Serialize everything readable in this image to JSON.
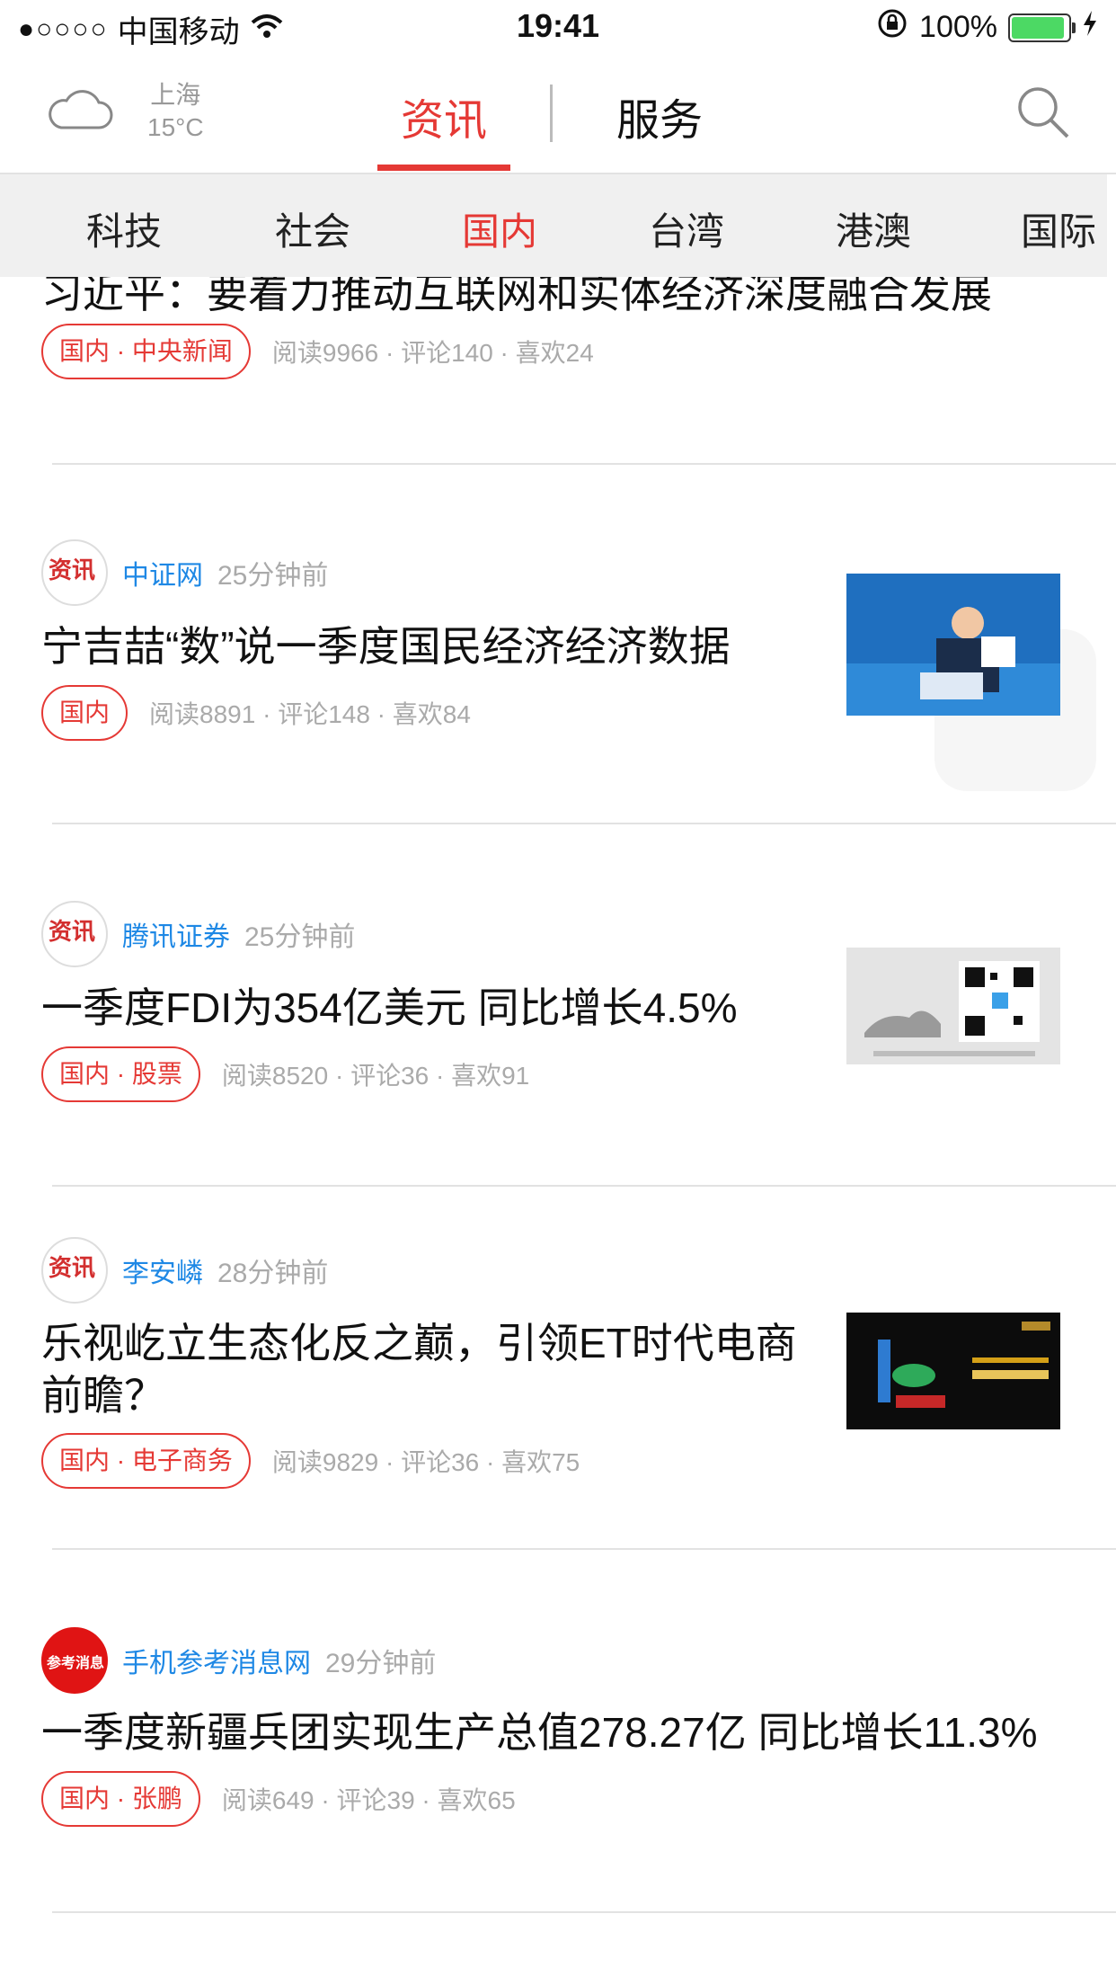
{
  "status_bar": {
    "signal_dots": "●○○○○",
    "carrier": "中国移动",
    "time": "19:41",
    "battery_percent_text": "100%",
    "battery_level": 1.0,
    "battery_color": "#4cd964"
  },
  "header": {
    "weather": {
      "city": "上海",
      "temp": "15°C",
      "icon": "cloud-icon"
    },
    "tabs": [
      {
        "label": "资讯",
        "active": true
      },
      {
        "label": "服务",
        "active": false
      }
    ],
    "accent_color": "#e53935"
  },
  "categories": [
    {
      "label": "科技"
    },
    {
      "label": "社会"
    },
    {
      "label": "国内",
      "active": true
    },
    {
      "label": "台湾"
    },
    {
      "label": "港澳"
    },
    {
      "label": "国际"
    }
  ],
  "articles": [
    {
      "title": "习近平：要着力推动互联网和实体经济深度融合发展",
      "tag": "国内 · 中央新闻",
      "stats": "阅读9966 · 评论140 · 喜欢24"
    },
    {
      "source": "中证网",
      "time": "25分钟前",
      "title": "宁吉喆“数”说一季度国民经济经济数据",
      "tag": "国内",
      "stats": "阅读8891 · 评论148 · 喜欢84",
      "avatar_text": "资讯"
    },
    {
      "source": "腾讯证券",
      "time": "25分钟前",
      "title": "一季度FDI为354亿美元 同比增长4.5%",
      "tag": "国内 · 股票",
      "stats": "阅读8520 · 评论36 · 喜欢91",
      "avatar_text": "资讯"
    },
    {
      "source": "李安嶙",
      "time": "28分钟前",
      "title": "乐视屹立生态化反之巅，引领ET时代电商前瞻？",
      "tag": "国内 · 电子商务",
      "stats": "阅读9829 · 评论36 · 喜欢75",
      "avatar_text": "资讯"
    },
    {
      "source": "手机参考消息网",
      "time": "29分钟前",
      "title": "一季度新疆兵团实现生产总值278.27亿 同比增长11.3%",
      "tag": "国内 · 张鹏",
      "stats": "阅读649 · 评论39 · 喜欢65",
      "avatar_text": "参考消息"
    }
  ]
}
